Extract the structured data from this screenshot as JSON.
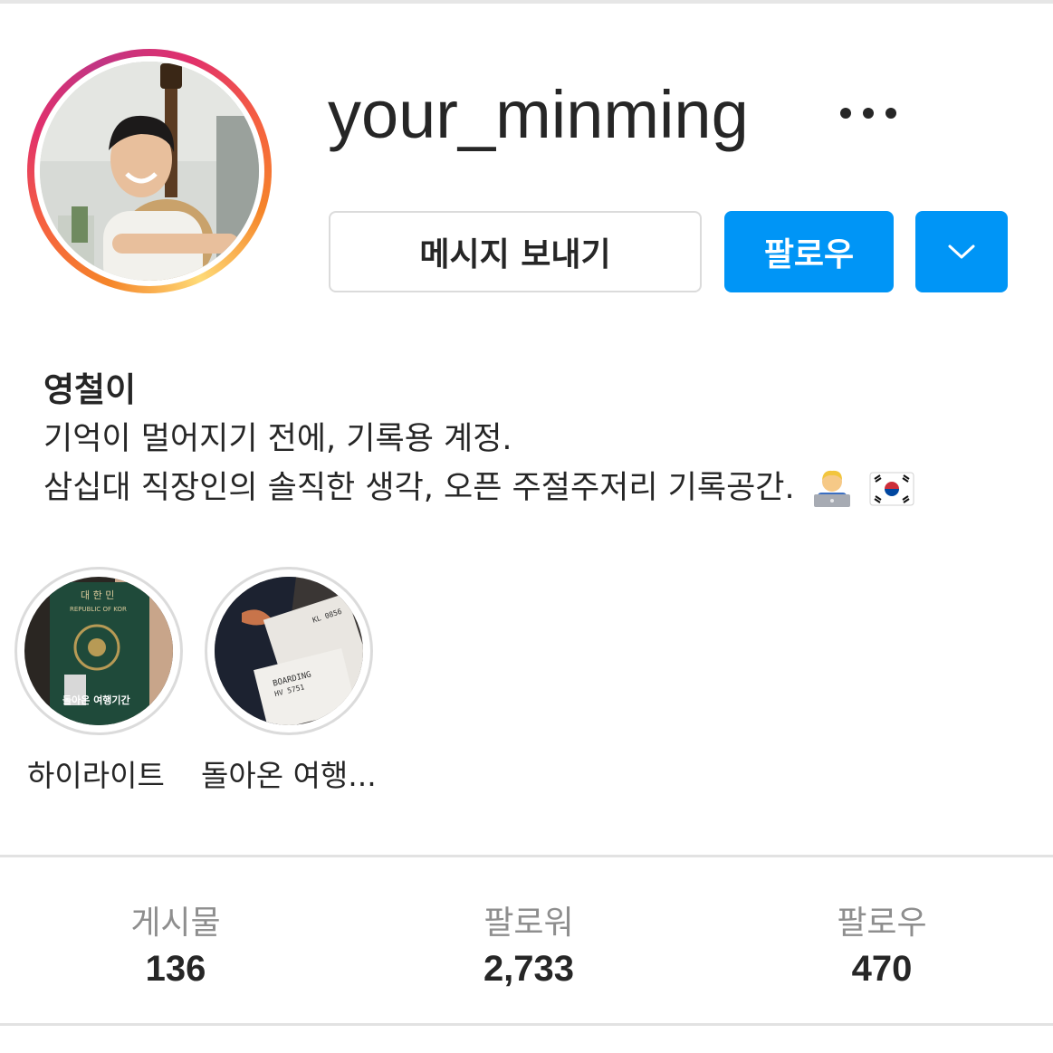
{
  "profile": {
    "username": "your_minming",
    "more_icon": "more-horizontal-icon"
  },
  "actions": {
    "message_label": "메시지 보내기",
    "follow_label": "팔로우",
    "dropdown_icon": "chevron-down-icon"
  },
  "bio": {
    "name": "영철이",
    "line1": "기억이 멀어지기 전에, 기록용 계정.",
    "line2": "삼십대 직장인의 솔직한 생각, 오픈 주절주저리 기록공간.",
    "emojis": [
      "man-technologist-emoji",
      "south-korea-flag-emoji"
    ]
  },
  "highlights": [
    {
      "label": "하이라이트",
      "overlay_text": "돌아온 여행기간",
      "cover_texts": [
        "대 한 민",
        "REPUBLIC OF KOR"
      ]
    },
    {
      "label": "돌아온 여행...",
      "cover_texts": [
        "BOARDING",
        "HV 5751",
        "KL 0856"
      ]
    }
  ],
  "stats": [
    {
      "label": "게시물",
      "value": "136"
    },
    {
      "label": "팔로워",
      "value": "2,733"
    },
    {
      "label": "팔로우",
      "value": "470"
    }
  ],
  "colors": {
    "accent": "#0095f6",
    "text": "#262626",
    "muted": "#8e8e8e",
    "border": "#dbdbdb"
  }
}
